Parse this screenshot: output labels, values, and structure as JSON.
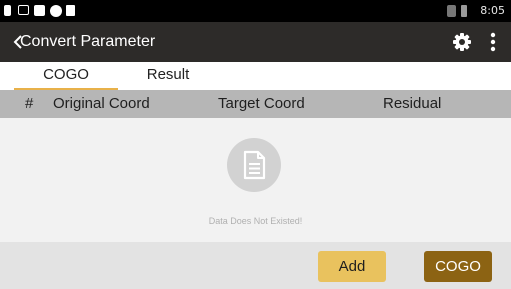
{
  "status_bar": {
    "time": "8:05",
    "icons": [
      "notification-icon",
      "image-icon",
      "app-icon",
      "circle-icon",
      "lock-icon",
      "no-sim-icon",
      "battery-icon"
    ]
  },
  "app_bar": {
    "title": "Convert Parameter",
    "icons": [
      "back-chevron-icon",
      "gear-icon",
      "more-vert-icon"
    ]
  },
  "tabs": [
    {
      "label": "COGO",
      "active": true
    },
    {
      "label": "Result",
      "active": false
    }
  ],
  "table": {
    "columns": [
      "#",
      "Original Coord",
      "Target Coord",
      "Residual"
    ],
    "rows": []
  },
  "empty_state": {
    "icon": "document-icon",
    "message": "Data Does Not Existed!"
  },
  "actions": {
    "add_label": "Add",
    "cogo_label": "COGO"
  },
  "colors": {
    "app_bar_bg": "#2d2b29",
    "tab_indicator": "#e8b14a",
    "table_header_bg": "#b6b6b6",
    "add_button": "#e9c25e",
    "cogo_button": "#8c6313"
  }
}
